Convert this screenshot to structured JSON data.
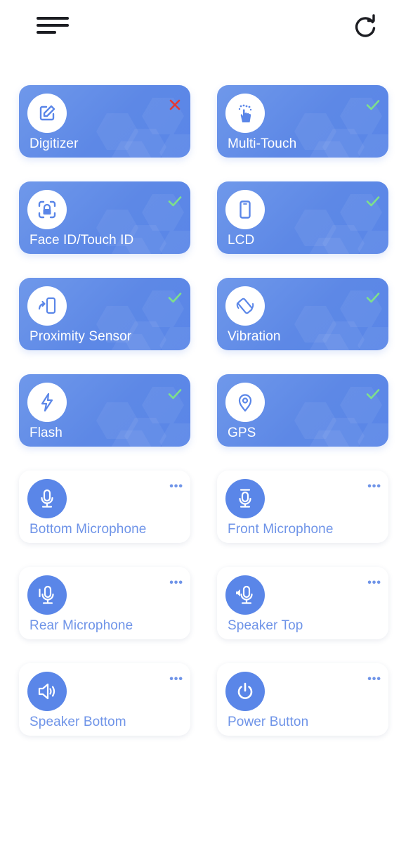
{
  "header": {
    "menu_icon": "hamburger-menu-icon",
    "refresh_icon": "refresh-icon"
  },
  "colors": {
    "accent": "#5a86e8",
    "pass": "#7ee08a",
    "fail": "#e53935",
    "untested_label": "#6f94e8"
  },
  "tests": [
    {
      "label": "Digitizer",
      "icon": "edit-pencil-icon",
      "status": "fail"
    },
    {
      "label": "Multi-Touch",
      "icon": "hand-touch-icon",
      "status": "pass"
    },
    {
      "label": "Face ID/Touch ID",
      "icon": "face-id-icon",
      "status": "pass"
    },
    {
      "label": "LCD",
      "icon": "phone-screen-icon",
      "status": "pass"
    },
    {
      "label": "Proximity Sensor",
      "icon": "proximity-icon",
      "status": "pass"
    },
    {
      "label": "Vibration",
      "icon": "vibration-icon",
      "status": "pass"
    },
    {
      "label": "Flash",
      "icon": "flash-bolt-icon",
      "status": "pass"
    },
    {
      "label": "GPS",
      "icon": "location-pin-icon",
      "status": "pass"
    },
    {
      "label": "Bottom Microphone",
      "icon": "microphone-icon",
      "status": "untested"
    },
    {
      "label": "Front Microphone",
      "icon": "front-microphone-icon",
      "status": "untested"
    },
    {
      "label": "Rear Microphone",
      "icon": "rear-microphone-icon",
      "status": "untested"
    },
    {
      "label": "Speaker Top",
      "icon": "speaker-top-icon",
      "status": "untested"
    },
    {
      "label": "Speaker Bottom",
      "icon": "speaker-icon",
      "status": "untested"
    },
    {
      "label": "Power Button",
      "icon": "power-icon",
      "status": "untested"
    }
  ],
  "more_label": "•••"
}
